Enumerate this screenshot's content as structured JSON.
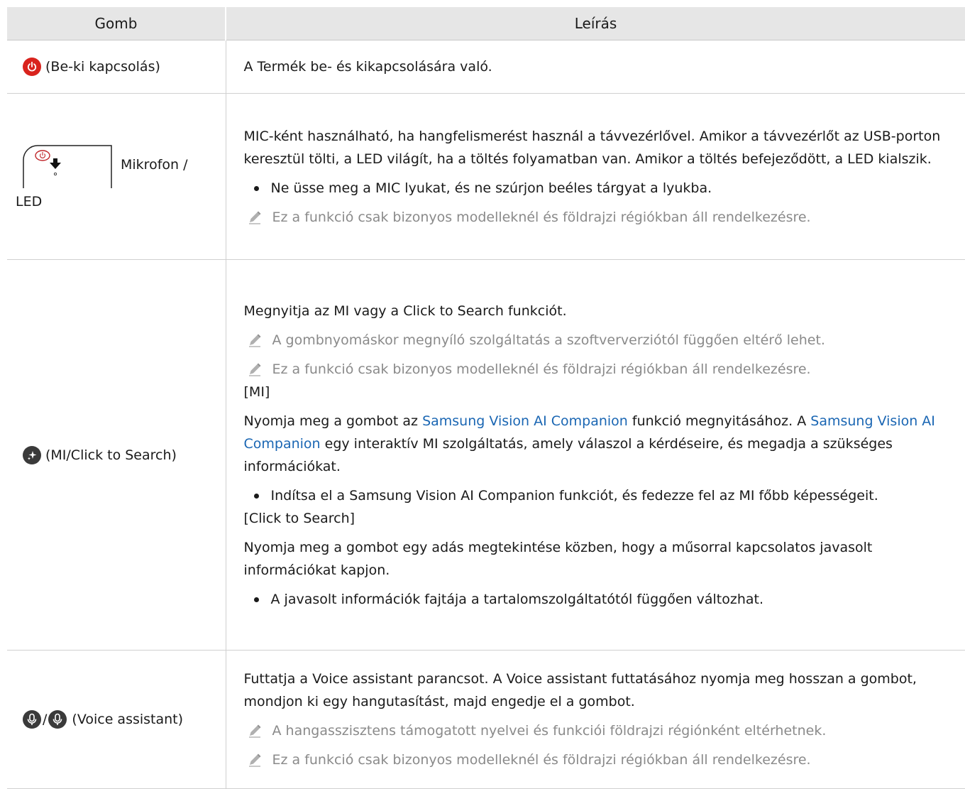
{
  "header": {
    "col_key": "Gomb",
    "col_desc": "Leírás"
  },
  "rows": {
    "power": {
      "label": "(Be-ki kapcsolás)",
      "icon": "power-icon",
      "desc": "A Termék be- és kikapcsolására való."
    },
    "mic": {
      "label_a": "Mikrofon /",
      "label_b": "LED",
      "icon": "remote-mic-led-illustration",
      "desc": "MIC-ként használható, ha hangfelismerést használ a távvezérlővel. Amikor a távvezérlőt az USB-porton keresztül tölti, a LED világít, ha a töltés folyamatban van. Amikor a töltés befejeződött, a LED kialszik.",
      "bullet": "Ne üsse meg a MIC lyukat, és ne szúrjon beéles tárgyat a lyukba.",
      "note": "Ez a funkció csak bizonyos modelleknél és földrajzi régiókban áll rendelkezésre."
    },
    "mi": {
      "label": "(MI/Click to Search)",
      "icon": "ai-sparkle-icon",
      "intro_a": "Megnyitja az ",
      "intro_mi": "MI",
      "intro_b": " vagy a ",
      "intro_cts": "Click to Search",
      "intro_c": " funkciót.",
      "note1": "A gombnyomáskor megnyíló szolgáltatás a szoftververziótól függően eltérő lehet.",
      "note2": "Ez a funkció csak bizonyos modelleknél és földrajzi régiókban áll rendelkezésre.",
      "sub1_open": "[",
      "sub1": "MI",
      "sub1_close": "]",
      "p1_a": "Nyomja meg a gombot az ",
      "p1_link1": "Samsung Vision AI Companion",
      "p1_b": " funkció megnyitásához. A ",
      "p1_link2": "Samsung Vision AI Companion",
      "p1_c": " egy interaktív MI szolgáltatás, amely válaszol a kérdéseire, és megadja a szükséges információkat.",
      "bullet1": "Indítsa el a Samsung Vision AI Companion funkciót, és fedezze fel az MI főbb képességeit.",
      "sub2_open": "[",
      "sub2": "Click to Search",
      "sub2_close": "]",
      "p2": "Nyomja meg a gombot egy adás megtekintése közben, hogy a műsorral kapcsolatos javasolt információkat kapjon.",
      "bullet2": "A javasolt információk fajtája a tartalomszolgáltatótól függően változhat."
    },
    "voice": {
      "sep": "/",
      "label": "(Voice assistant)",
      "icon": "microphone-icon",
      "desc": "Futtatja a Voice assistant parancsot. A Voice assistant futtatásához nyomja meg hosszan a gombot, mondjon ki egy hangutasítást, majd engedje el a gombot.",
      "note1": "A hangasszisztens támogatott nyelvei és funkciói földrajzi régiónként eltérhetnek.",
      "note2": "Ez a funkció csak bizonyos modelleknél és földrajzi régiókban áll rendelkezésre."
    }
  },
  "colors": {
    "header_bg": "#e6e6e6",
    "link": "#1a66b3",
    "note": "#8a8a8a",
    "power_red": "#d9231d"
  }
}
